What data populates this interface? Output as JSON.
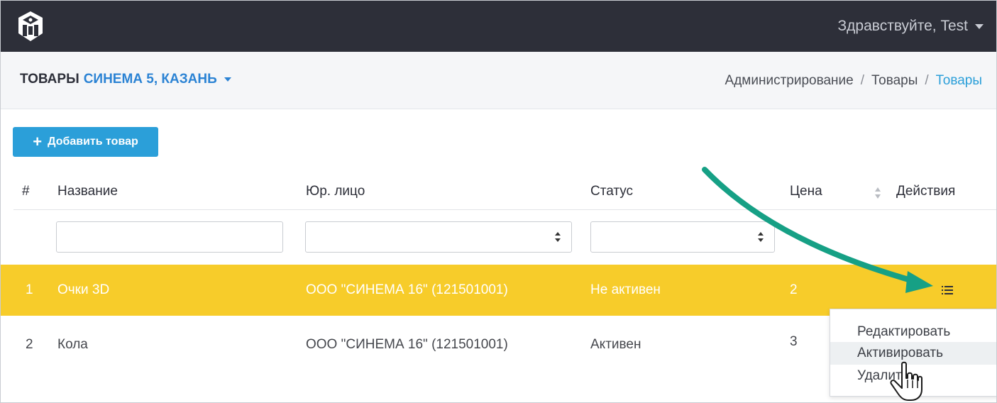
{
  "topbar": {
    "greeting": "Здравствуйте, Test"
  },
  "subheader": {
    "title_main": "ТОВАРЫ",
    "title_location": "СИНЕМА 5, КАЗАНЬ",
    "breadcrumb": [
      "Администрирование",
      "Товары",
      "Товары"
    ]
  },
  "toolbar": {
    "add_label": "Добавить товар"
  },
  "table": {
    "columns": [
      "#",
      "Название",
      "Юр. лицо",
      "Статус",
      "Цена",
      "Действия"
    ],
    "rows": [
      {
        "num": "1",
        "name": "Очки 3D",
        "entity": "ООО \"СИНЕМА 16\" (121501001)",
        "status": "Не активен",
        "price": "2"
      },
      {
        "num": "2",
        "name": "Кола",
        "entity": "ООО \"СИНЕМА 16\" (121501001)",
        "status": "Активен",
        "price": "3"
      }
    ]
  },
  "dropdown": {
    "items": [
      "Редактировать",
      "Активировать",
      "Удалить"
    ]
  },
  "colors": {
    "topbar": "#2d2f39",
    "accent_blue": "#2b9fd9",
    "highlight_row": "#f7cc2a",
    "annotation_arrow": "#16a085"
  }
}
